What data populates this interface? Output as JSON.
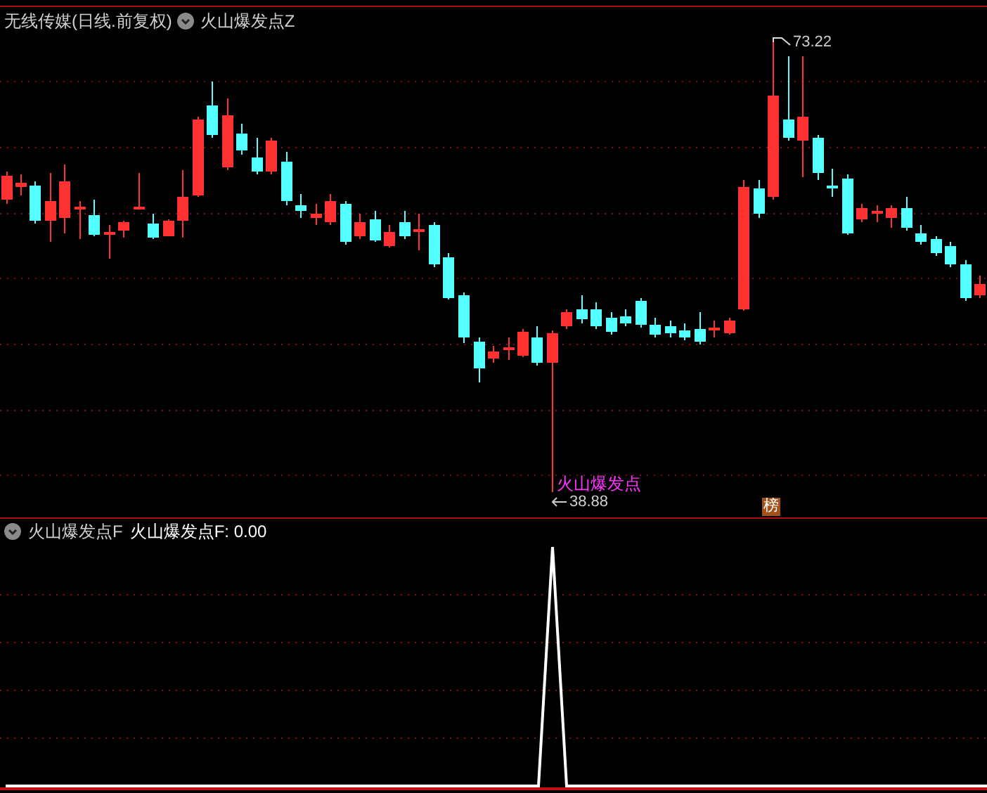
{
  "header": {
    "title": "无线传媒(日线.前复权)",
    "indicator": "火山爆发点Z"
  },
  "main_chart": {
    "high_label": "73.22",
    "low_label": "38.88",
    "signal_label": "火山爆发点",
    "badge": "榜"
  },
  "sub_panel": {
    "indicator": "火山爆发点F",
    "reading": "火山爆发点F: 0.00"
  }
}
